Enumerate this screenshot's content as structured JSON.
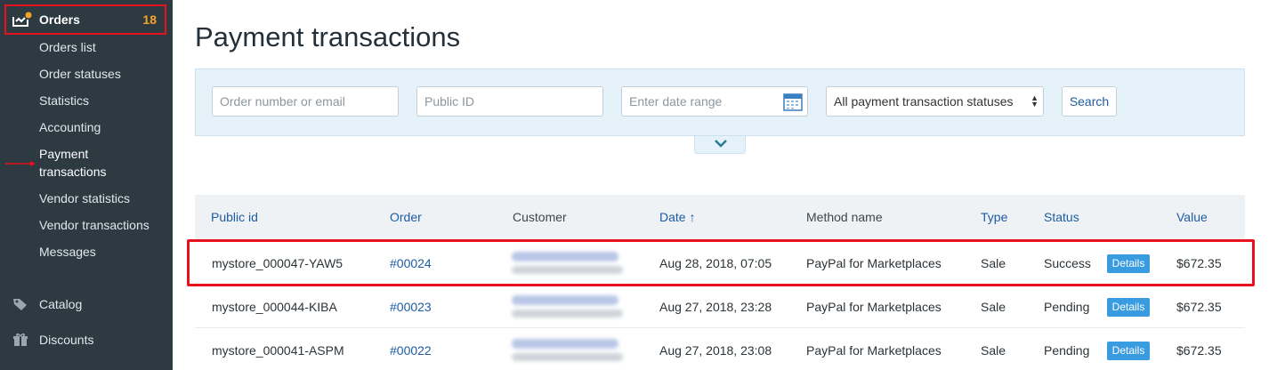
{
  "sidebar": {
    "orders": {
      "title": "Orders",
      "count": "18",
      "icon": "orders-icon"
    },
    "items": [
      {
        "label": "Orders list"
      },
      {
        "label": "Order statuses"
      },
      {
        "label": "Statistics"
      },
      {
        "label": "Accounting"
      },
      {
        "label": "Payment transactions"
      },
      {
        "label": "Vendor statistics"
      },
      {
        "label": "Vendor transactions"
      },
      {
        "label": "Messages"
      }
    ],
    "sections": [
      {
        "label": "Catalog",
        "icon": "tag-icon"
      },
      {
        "label": "Discounts",
        "icon": "gift-icon"
      }
    ]
  },
  "page": {
    "title": "Payment transactions"
  },
  "filters": {
    "order_placeholder": "Order number or email",
    "public_id_placeholder": "Public ID",
    "date_placeholder": "Enter date range",
    "status_selected": "All payment transaction statuses",
    "search_label": "Search"
  },
  "table": {
    "headers": {
      "public_id": "Public id",
      "order": "Order",
      "customer": "Customer",
      "date": "Date ↑",
      "method": "Method name",
      "type": "Type",
      "status": "Status",
      "value": "Value"
    },
    "details_label": "Details",
    "rows": [
      {
        "public_id": "mystore_000047-YAW5",
        "order": "#00024",
        "date": "Aug 28, 2018, 07:05",
        "method": "PayPal for Marketplaces",
        "type": "Sale",
        "status": "Success",
        "value": "$672.35"
      },
      {
        "public_id": "mystore_000044-KIBA",
        "order": "#00023",
        "date": "Aug 27, 2018, 23:28",
        "method": "PayPal for Marketplaces",
        "type": "Sale",
        "status": "Pending",
        "value": "$672.35"
      },
      {
        "public_id": "mystore_000041-ASPM",
        "order": "#00022",
        "date": "Aug 27, 2018, 23:08",
        "method": "PayPal for Marketplaces",
        "type": "Sale",
        "status": "Pending",
        "value": "$672.35"
      }
    ]
  },
  "colors": {
    "sidebar_bg": "#2d3a42",
    "accent_link": "#1d5ca3",
    "highlight_red": "#e8111d",
    "count_orange": "#f7a325",
    "details_blue": "#3a9ce0"
  }
}
